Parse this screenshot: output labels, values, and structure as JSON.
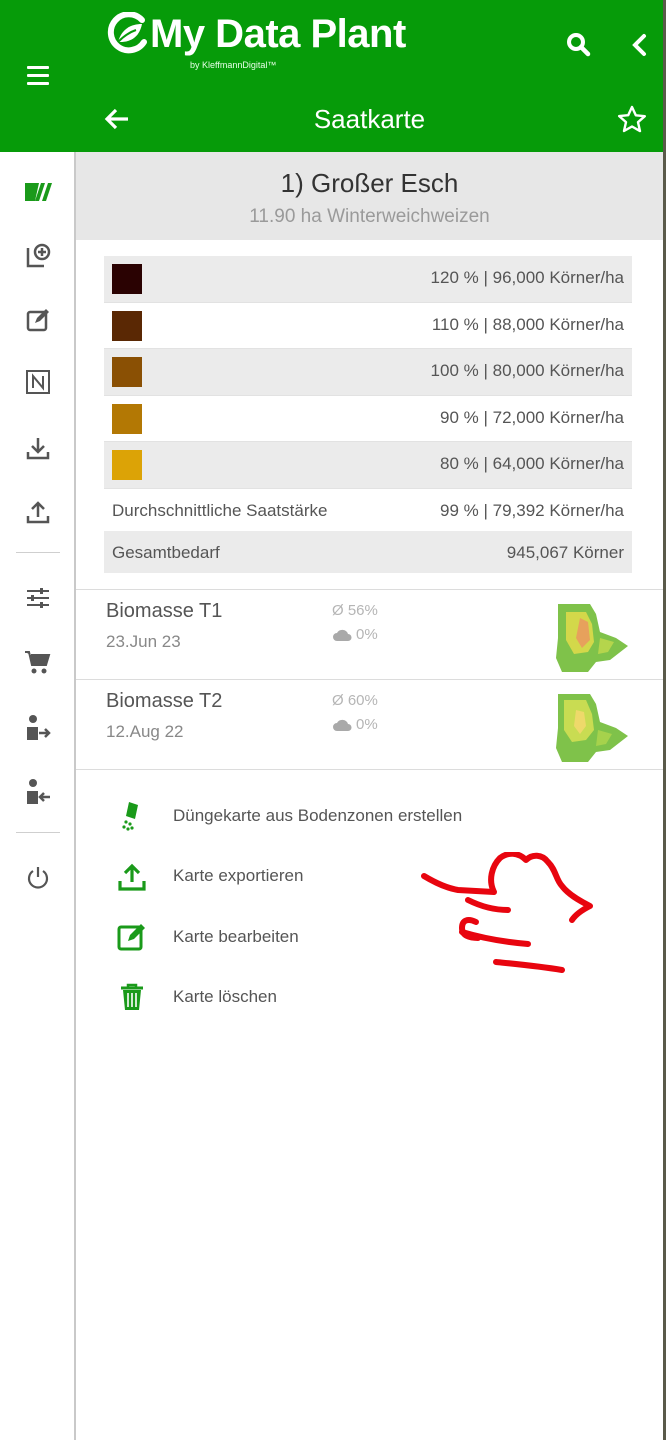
{
  "brand": {
    "title": "My Data Plant",
    "subtitle": "by KleffmannDigital™",
    "color": "#069b09"
  },
  "header": {
    "screen_title": "Saatkarte"
  },
  "sidebar": {
    "icons": [
      "field-map-icon",
      "add-map-icon",
      "edit-icon",
      "notion-n-icon",
      "download-icon",
      "upload-icon",
      "sliders-icon",
      "cart-icon",
      "user-export-icon",
      "user-import-icon",
      "power-icon"
    ]
  },
  "field": {
    "name": "1) Großer Esch",
    "info": "11.90 ha Winterweichweizen"
  },
  "rates": [
    {
      "color": "#2a0202",
      "label": "120 % | 96,000 Körner/ha"
    },
    {
      "color": "#5a2804",
      "label": "110 % | 88,000 Körner/ha"
    },
    {
      "color": "#8a5004",
      "label": "100 % | 80,000 Körner/ha"
    },
    {
      "color": "#b37804",
      "label": "90 % | 72,000 Körner/ha"
    },
    {
      "color": "#dca306",
      "label": "80 % | 64,000 Körner/ha"
    }
  ],
  "summary": {
    "avg_label": "Durchschnittliche Saatstärke",
    "avg_value": "99 % | 79,392 Körner/ha",
    "total_label": "Gesamtbedarf",
    "total_value": "945,067 Körner"
  },
  "biomass": [
    {
      "name": "Biomasse T1",
      "date": "23.Jun 23",
      "avg": "Ø 56%",
      "cloud": "0%"
    },
    {
      "name": "Biomasse T2",
      "date": "12.Aug 22",
      "avg": "Ø 60%",
      "cloud": "0%"
    }
  ],
  "actions": [
    {
      "icon": "fertilizer-icon",
      "label": "Düngekarte aus Bodenzonen erstellen"
    },
    {
      "icon": "export-icon",
      "label": "Karte exportieren"
    },
    {
      "icon": "edit-icon",
      "label": "Karte bearbeiten"
    },
    {
      "icon": "trash-icon",
      "label": "Karte löschen"
    }
  ]
}
